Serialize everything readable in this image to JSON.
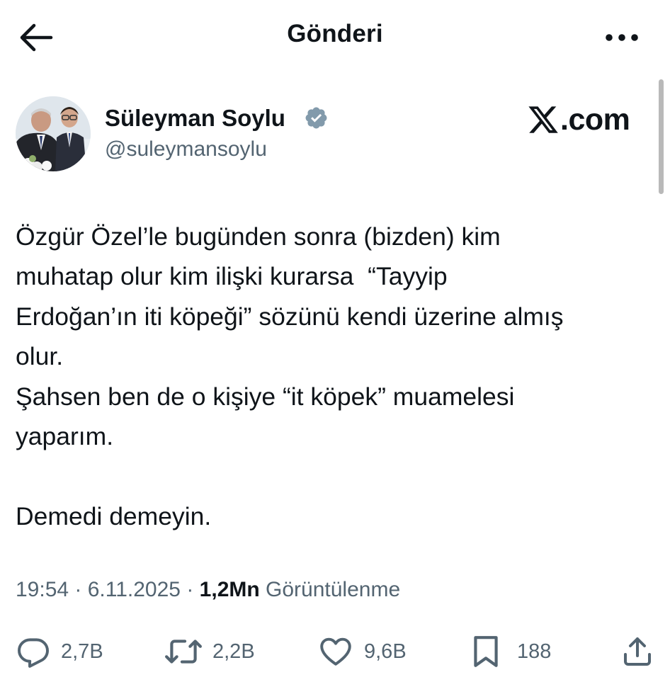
{
  "header": {
    "title": "Gönderi",
    "back_icon": "arrow-left-icon",
    "more_icon": "more-horizontal-icon"
  },
  "author": {
    "name": "Süleyman Soylu",
    "handle": "@suleymansoylu",
    "verified_icon": "verified-badge-icon",
    "verified_color": "#829aab"
  },
  "watermark": {
    "suffix": ".com"
  },
  "tweet": {
    "lines": [
      "Özgür Özel’le bugünden sonra (bizden) kim",
      "muhatap olur kim ilişki kurarsa  “Tayyip",
      "Erdoğan’ın iti köpeği” sözünü kendi üzerine almış",
      "olur.",
      "Şahsen ben de o kişiye “it köpek” muamelesi",
      "yaparım.",
      "",
      "Demedi demeyin."
    ]
  },
  "meta": {
    "time": "19:54",
    "separator": " · ",
    "date": "6.11.2025",
    "views_count": "1,2Mn",
    "views_label": " Görüntülenme"
  },
  "actions": {
    "replies": "2,7B",
    "reposts": "2,2B",
    "likes": "9,6B",
    "bookmarks": "188"
  },
  "colors": {
    "text": "#0f1419",
    "secondary": "#536471",
    "background": "#ffffff"
  }
}
